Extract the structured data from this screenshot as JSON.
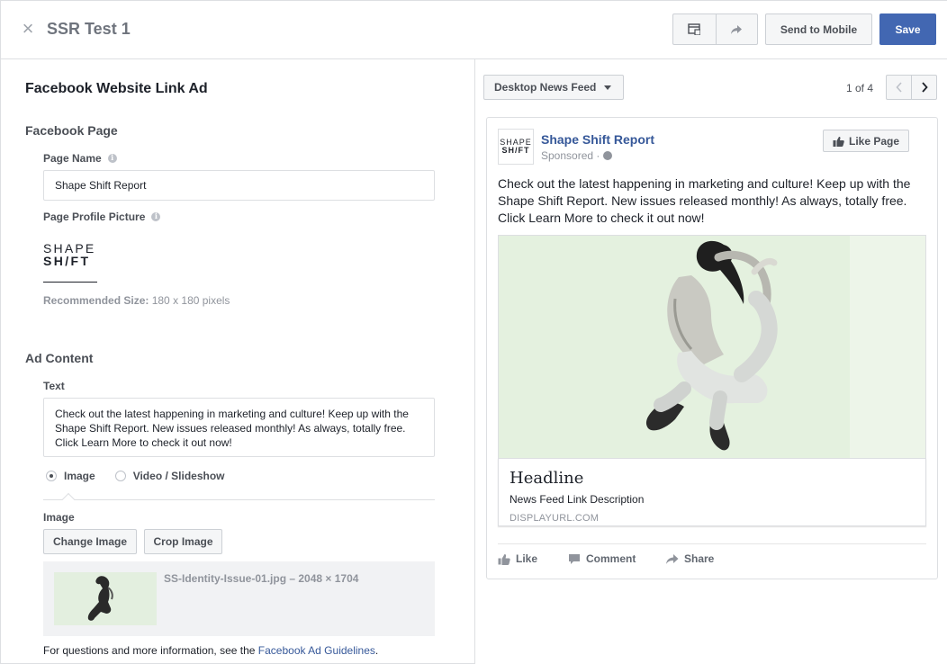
{
  "header": {
    "title": "SSR Test 1",
    "send_to_mobile": "Send to Mobile",
    "save": "Save",
    "icons": [
      "close-icon",
      "preview-icon",
      "share-arrow-icon"
    ]
  },
  "left": {
    "ad_type_title": "Facebook Website Link Ad",
    "facebook_page_section": "Facebook Page",
    "page_name_label": "Page Name",
    "page_name_value": "Shape Shift Report",
    "profile_picture_label": "Page Profile Picture",
    "logo_line1": "SHAPE",
    "logo_line2": "SH/FT",
    "recommended_label": "Recommended Size:",
    "recommended_value": " 180 x 180 pixels",
    "ad_content_section": "Ad Content",
    "text_label": "Text",
    "text_value": "Check out the latest happening in marketing and culture! Keep up with the Shape Shift Report. New issues released monthly! As always, totally free. Click Learn More to check it out now!",
    "media_options": [
      {
        "label": "Image",
        "selected": true
      },
      {
        "label": "Video / Slideshow",
        "selected": false
      }
    ],
    "image_label": "Image",
    "change_image": "Change Image",
    "crop_image": "Crop Image",
    "file_name": "SS-Identity-Issue-01.jpg – 2048 × 1704",
    "footer_prefix": "For questions and more information, see the ",
    "footer_link": "Facebook Ad Guidelines",
    "footer_suffix": "."
  },
  "right": {
    "placement": "Desktop News Feed",
    "pager": "1 of 4",
    "post": {
      "avatar_line1": "SHAPE",
      "avatar_line2": "SH/FT",
      "page_name": "Shape Shift Report",
      "sponsored": "Sponsored ·",
      "like_page": "Like Page",
      "text": "Check out the latest happening in marketing and culture! Keep up with the Shape Shift Report. New issues released monthly! As always, totally free. Click Learn More to check it out now!",
      "headline": "Headline",
      "description": "News Feed Link Description",
      "display_url": "DISPLAYURL.COM",
      "actions": [
        "Like",
        "Comment",
        "Share"
      ]
    }
  },
  "colors": {
    "accent": "#4267b2",
    "link": "#365899",
    "image_bg": "#e4f1df"
  }
}
